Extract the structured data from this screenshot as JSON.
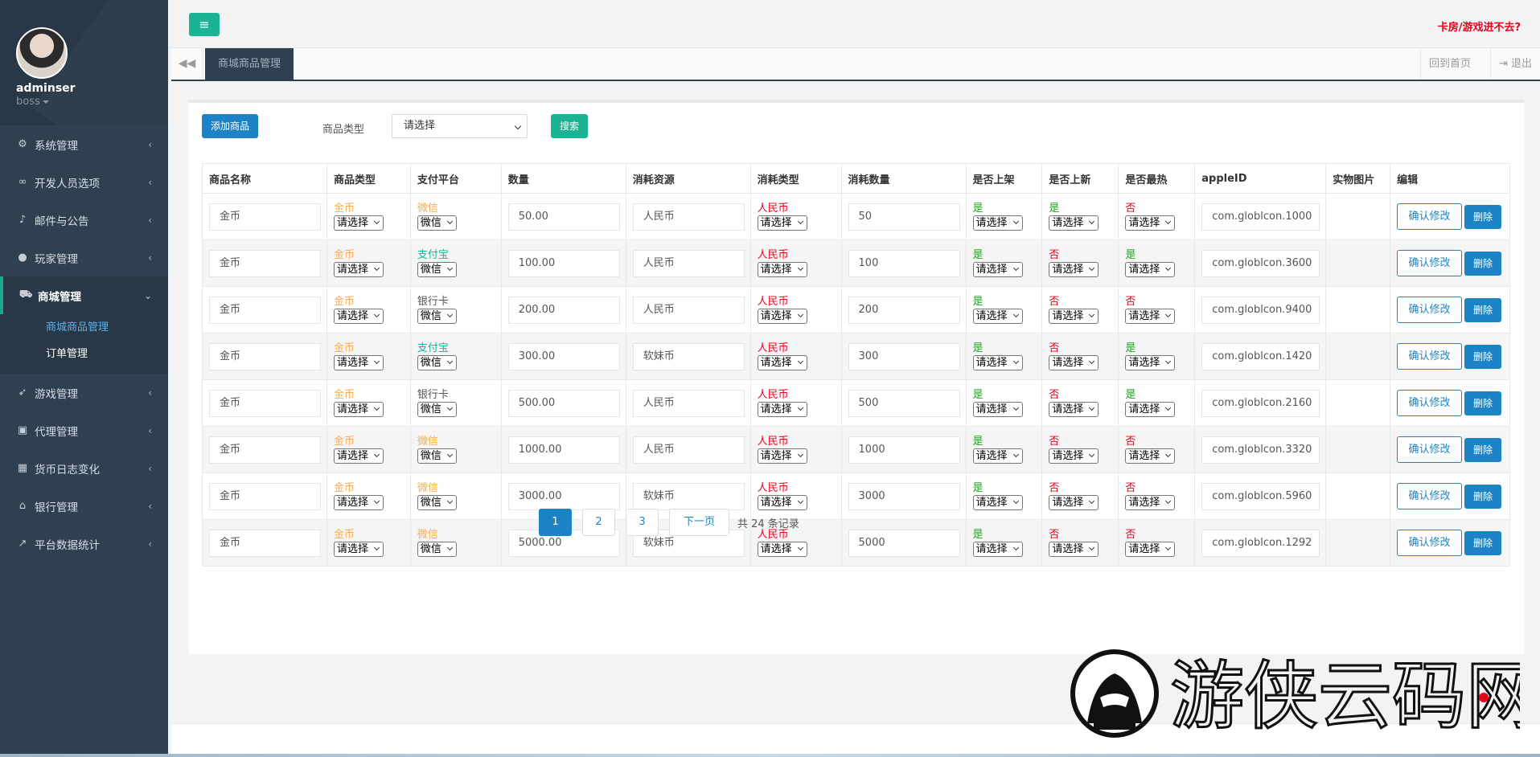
{
  "sidebar": {
    "user": "adminser",
    "role": "boss",
    "menu": [
      {
        "label": "系统管理",
        "icon": "gears-icon"
      },
      {
        "label": "开发人员选项",
        "icon": "link-icon"
      },
      {
        "label": "邮件与公告",
        "icon": "bell-icon"
      },
      {
        "label": "玩家管理",
        "icon": "user-icon"
      },
      {
        "label": "商城管理",
        "icon": "cart-icon"
      },
      {
        "label": "游戏管理",
        "icon": "rocket-icon"
      },
      {
        "label": "代理管理",
        "icon": "lock-icon"
      },
      {
        "label": "货币日志变化",
        "icon": "calendar-icon"
      },
      {
        "label": "银行管理",
        "icon": "bank-icon"
      },
      {
        "label": "平台数据统计",
        "icon": "chart-icon"
      }
    ],
    "submenu": [
      "商城商品管理",
      "订单管理"
    ]
  },
  "topbar": {
    "link": "卡房/游戏进不去?"
  },
  "tabs": {
    "active": "商城商品管理",
    "home": "回到首页",
    "logout": "退出"
  },
  "filter": {
    "add_label": "添加商品",
    "type_label": "商品类型",
    "type_value": "请选择",
    "search_label": "搜索"
  },
  "table": {
    "headers": [
      "商品名称",
      "商品类型",
      "支付平台",
      "数量",
      "消耗资源",
      "消耗类型",
      "消耗数量",
      "是否上架",
      "是否上新",
      "是否最热",
      "appleID",
      "实物图片",
      "编辑"
    ],
    "select_placeholder": "请选择",
    "pay_select": "微信",
    "confirm_label": "确认修改",
    "delete_label": "删除",
    "rows": [
      {
        "name": "金币",
        "type": "金币",
        "pay": "微信",
        "qty": "50.00",
        "res": "人民币",
        "ctype": "人民币",
        "cnum": "50",
        "shelf": "是",
        "new": "是",
        "hot": "否",
        "apple": "com.globlcon.1000"
      },
      {
        "name": "金币",
        "type": "金币",
        "pay": "支付宝",
        "qty": "100.00",
        "res": "人民币",
        "ctype": "人民币",
        "cnum": "100",
        "shelf": "是",
        "new": "否",
        "hot": "是",
        "apple": "com.globlcon.3600"
      },
      {
        "name": "金币",
        "type": "金币",
        "pay": "银行卡",
        "qty": "200.00",
        "res": "人民币",
        "ctype": "人民币",
        "cnum": "200",
        "shelf": "是",
        "new": "否",
        "hot": "否",
        "apple": "com.globlcon.9400"
      },
      {
        "name": "金币",
        "type": "金币",
        "pay": "支付宝",
        "qty": "300.00",
        "res": "软妹币",
        "ctype": "人民币",
        "cnum": "300",
        "shelf": "是",
        "new": "否",
        "hot": "是",
        "apple": "com.globlcon.1420"
      },
      {
        "name": "金币",
        "type": "金币",
        "pay": "银行卡",
        "qty": "500.00",
        "res": "人民币",
        "ctype": "人民币",
        "cnum": "500",
        "shelf": "是",
        "new": "否",
        "hot": "是",
        "apple": "com.globlcon.2160"
      },
      {
        "name": "金币",
        "type": "金币",
        "pay": "微信",
        "qty": "1000.00",
        "res": "人民币",
        "ctype": "人民币",
        "cnum": "1000",
        "shelf": "是",
        "new": "否",
        "hot": "否",
        "apple": "com.globlcon.3320"
      },
      {
        "name": "金币",
        "type": "金币",
        "pay": "微信",
        "qty": "3000.00",
        "res": "软妹币",
        "ctype": "人民币",
        "cnum": "3000",
        "shelf": "是",
        "new": "否",
        "hot": "否",
        "apple": "com.globlcon.5960"
      },
      {
        "name": "金币",
        "type": "金币",
        "pay": "微信",
        "qty": "5000.00",
        "res": "软妹币",
        "ctype": "人民币",
        "cnum": "5000",
        "shelf": "是",
        "new": "否",
        "hot": "否",
        "apple": "com.globlcon.1292"
      }
    ]
  },
  "pager": {
    "pages": [
      "1",
      "2",
      "3"
    ],
    "current": "1",
    "next": "下一页",
    "total": "共 24 条记录"
  },
  "watermark": "游侠云码网",
  "colors": {
    "sidebar": "#2f4050",
    "primary": "#1c84c6",
    "accent": "#1ab394",
    "red": "#e8001c",
    "orange": "#f8ac59",
    "green": "#1aa61a"
  }
}
